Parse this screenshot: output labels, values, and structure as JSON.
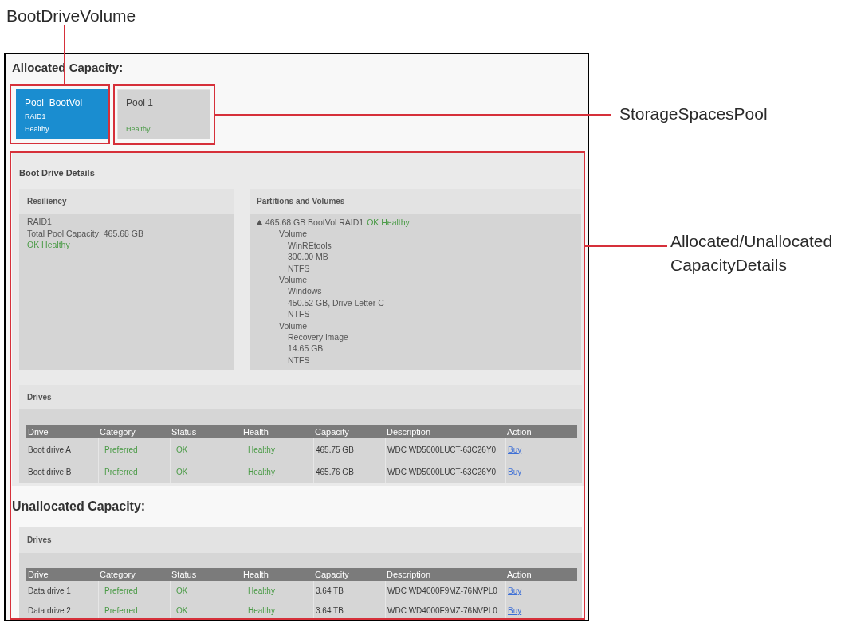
{
  "callouts": [
    {
      "text": "BootDriveVolume"
    },
    {
      "text": "StorageSpacesPool"
    },
    {
      "text": "Allocated/Unallocated CapacityDetails"
    }
  ],
  "allocated": {
    "heading": "Allocated Capacity:",
    "pools": [
      {
        "name": "Pool_BootVol",
        "raid": "RAID1",
        "health": "Healthy",
        "selected": true
      },
      {
        "name": "Pool 1",
        "health": "Healthy",
        "selected": false
      }
    ],
    "details": {
      "title": "Boot Drive Details",
      "resiliency": {
        "title": "Resiliency",
        "lines": [
          {
            "text": "RAID1",
            "kind": "plain"
          },
          {
            "text": "Total Pool Capacity: 465.68 GB",
            "kind": "plain"
          },
          {
            "text": "OK Healthy",
            "kind": "status"
          }
        ]
      },
      "partitions": {
        "title": "Partitions and Volumes",
        "tree": [
          {
            "text": "465.68 GB BootVol RAID1",
            "status": "OK Healthy",
            "expanded": true,
            "children": [
              {
                "text": "Volume",
                "children": [
                  {
                    "text": "WinREtools"
                  },
                  {
                    "text": "300.00 MB"
                  },
                  {
                    "text": "NTFS"
                  }
                ]
              },
              {
                "text": "Volume",
                "children": [
                  {
                    "text": "Windows"
                  },
                  {
                    "text": "450.52 GB, Drive Letter C"
                  },
                  {
                    "text": "NTFS"
                  }
                ]
              },
              {
                "text": "Volume",
                "children": [
                  {
                    "text": "Recovery image"
                  },
                  {
                    "text": "14.65 GB"
                  },
                  {
                    "text": "NTFS"
                  }
                ]
              }
            ]
          }
        ]
      },
      "drives": {
        "title": "Drives",
        "columns": [
          {
            "label": "Drive",
            "kind": "text"
          },
          {
            "label": "Category",
            "kind": "status"
          },
          {
            "label": "Status",
            "kind": "status"
          },
          {
            "label": "Health",
            "kind": "status"
          },
          {
            "label": "Capacity",
            "kind": "text"
          },
          {
            "label": "Description",
            "kind": "text"
          },
          {
            "label": "Action",
            "kind": "link"
          }
        ],
        "rows": [
          {
            "cells": [
              "Boot drive A",
              "Preferred",
              "OK",
              "Healthy",
              "465.75 GB",
              "WDC WD5000LUCT-63C26Y0",
              "Buy"
            ]
          },
          {
            "cells": [
              "Boot drive B",
              "Preferred",
              "OK",
              "Healthy",
              "465.76 GB",
              "WDC WD5000LUCT-63C26Y0",
              "Buy"
            ]
          }
        ]
      }
    }
  },
  "unallocated": {
    "heading": "Unallocated Capacity:",
    "drives": {
      "title": "Drives",
      "columns": [
        {
          "label": "Drive",
          "kind": "text"
        },
        {
          "label": "Category",
          "kind": "status"
        },
        {
          "label": "Status",
          "kind": "status"
        },
        {
          "label": "Health",
          "kind": "status"
        },
        {
          "label": "Capacity",
          "kind": "text"
        },
        {
          "label": "Description",
          "kind": "text"
        },
        {
          "label": "Action",
          "kind": "link"
        }
      ],
      "rows": [
        {
          "cells": [
            "Data drive 1",
            "Preferred",
            "OK",
            "Healthy",
            "3.64 TB",
            "WDC WD4000F9MZ-76NVPL0",
            "Buy"
          ]
        },
        {
          "cells": [
            "Data drive 2",
            "Preferred",
            "OK",
            "Healthy",
            "3.64 TB",
            "WDC WD4000F9MZ-76NVPL0",
            "Buy"
          ]
        }
      ]
    }
  }
}
